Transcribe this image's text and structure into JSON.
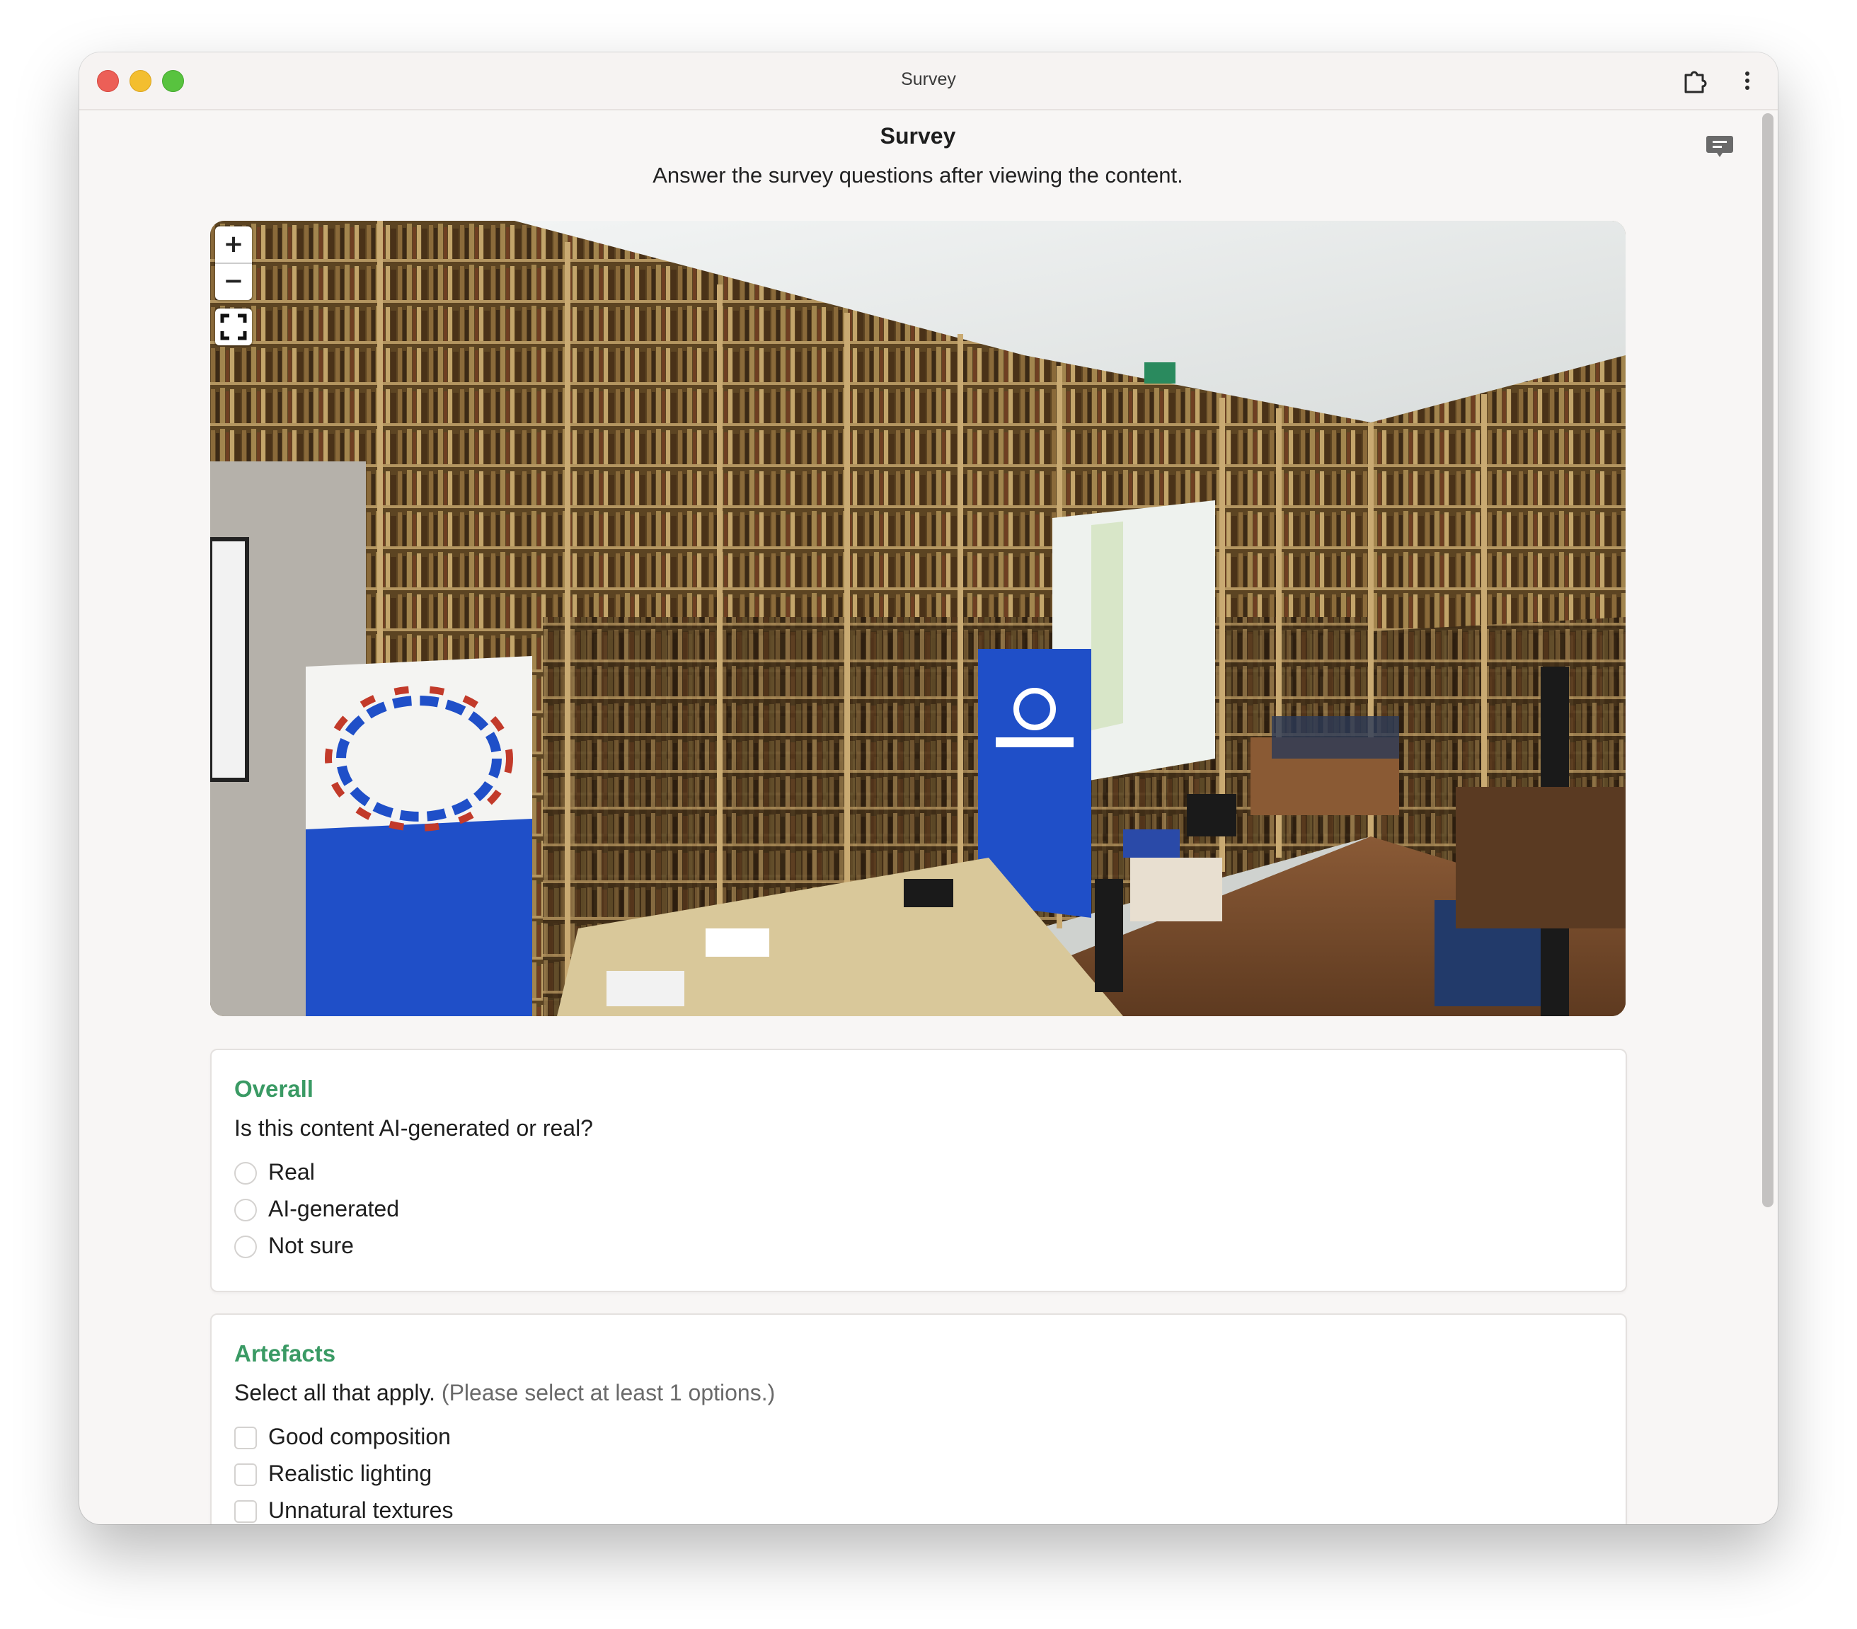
{
  "window": {
    "title": "Survey"
  },
  "header": {
    "title": "Survey",
    "subtitle": "Answer the survey questions after viewing the content."
  },
  "viewer": {
    "zoom_in_label": "+",
    "zoom_out_label": "−",
    "fullscreen_icon": "fullscreen-icon",
    "scene_description": "360° panorama of a library room with wooden bookshelves"
  },
  "sections": {
    "overall": {
      "heading": "Overall",
      "question": "Is this content AI-generated or real?",
      "options": [
        "Real",
        "AI-generated",
        "Not sure"
      ]
    },
    "artefacts": {
      "heading": "Artefacts",
      "question": "Select all that apply.",
      "hint": "(Please select at least 1 options.)",
      "options": [
        "Good composition",
        "Realistic lighting",
        "Unnatural textures"
      ]
    }
  },
  "colors": {
    "accent": "#3a9a64",
    "window_bg": "#f8f6f5"
  }
}
